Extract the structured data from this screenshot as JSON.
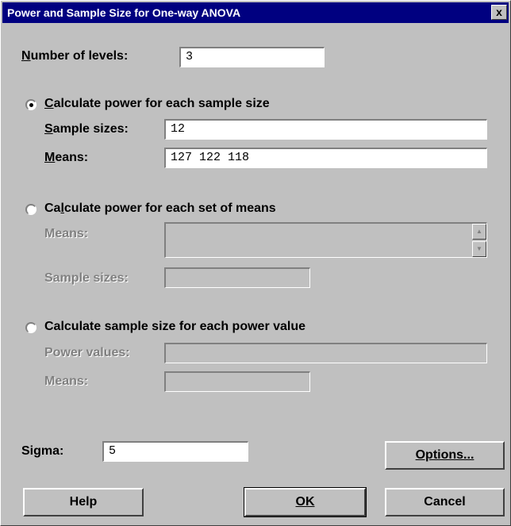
{
  "window": {
    "title": "Power and Sample Size for One-way ANOVA",
    "close_label": "x"
  },
  "levels": {
    "label_first": "N",
    "label_rest": "umber of levels:",
    "value": "3"
  },
  "option_power": {
    "label_first": "C",
    "label_rest": "alculate power for each sample size",
    "selected": true,
    "sample_sizes_label_first": "S",
    "sample_sizes_label_rest": "ample sizes:",
    "sample_sizes_value": "12",
    "means_label_first": "M",
    "means_label_rest": "eans:",
    "means_value": "127 122 118"
  },
  "option_means": {
    "label_first": "Ca",
    "label_mid": "l",
    "label_rest": "culate power for each set of means",
    "selected": false,
    "means_label": "Means:",
    "sample_sizes_label": "Sample sizes:"
  },
  "option_sample": {
    "label_first": "Calculate sample size for each power value",
    "selected": false,
    "power_values_label": "Power values:",
    "means_label": "Means:"
  },
  "sigma": {
    "label": "Sigma:",
    "value": "5"
  },
  "buttons": {
    "options": "Options...",
    "help": "Help",
    "ok": "OK",
    "cancel": "Cancel"
  },
  "colors": {
    "title_bar": "#000080",
    "dialog_face": "#c0c0c0",
    "disabled_text": "#808080"
  },
  "icons": {
    "close": "close-icon",
    "scroll_up": "scroll-up-arrow-icon",
    "scroll_down": "scroll-down-arrow-icon"
  }
}
